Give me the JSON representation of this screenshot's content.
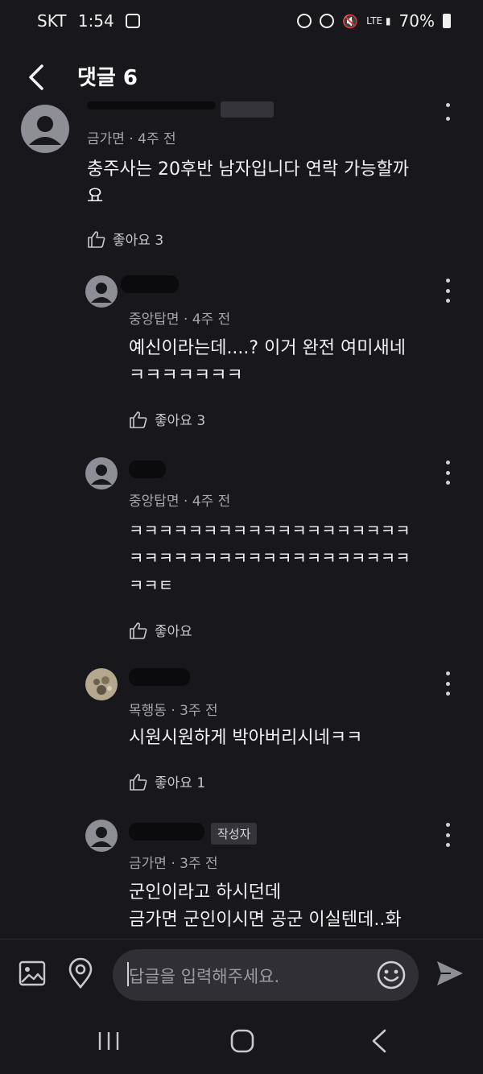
{
  "status_bar": {
    "carrier": "SKT",
    "time": "1:54",
    "battery": "70%"
  },
  "header": {
    "title": "댓글 6"
  },
  "comments": [
    {
      "meta": "금가면 · 4주 전",
      "body": "충주사는 20후반 남자입니다 연락 가능할까\n요",
      "like": "좋아요 3",
      "badge": ""
    },
    {
      "meta": "중앙탑면 · 4주 전",
      "body": "예신이라는데....? 이거 완전 여미새네\nㅋㅋㅋㅋㅋㅋㅋ",
      "like": "좋아요 3",
      "badge": ""
    },
    {
      "meta": "중앙탑면 · 4주 전",
      "body": "ㅋㅋㅋㅋㅋㅋㅋㅋㅋㅋㅋㅋㅋㅋㅋㅋㅋㅋㅋ\nㅋㅋㅋㅋㅋㅋㅋㅋㅋㅋㅋㅋㅋㅋㅋㅋㅋㅋㅋ\nㅋㅋㅌ",
      "like": "좋아요",
      "badge": ""
    },
    {
      "meta": "목행동 · 3주 전",
      "body": "시원시원하게 박아버리시네ㅋㅋ",
      "like": "좋아요 1",
      "badge": ""
    },
    {
      "meta": "금가면 · 3주 전",
      "body": "군인이라고 하시던데\n금가면 군인이시면 공군 이실텐데..화",
      "like": "",
      "badge": "작성자"
    }
  ],
  "input": {
    "placeholder": "답글을 입력해주세요."
  },
  "icons": {
    "back": "chevron-left-icon",
    "image": "image-icon",
    "location": "location-pin-icon",
    "emoji": "smiley-icon",
    "send": "send-icon",
    "like": "thumbs-up-icon",
    "more": "kebab-menu-icon"
  }
}
